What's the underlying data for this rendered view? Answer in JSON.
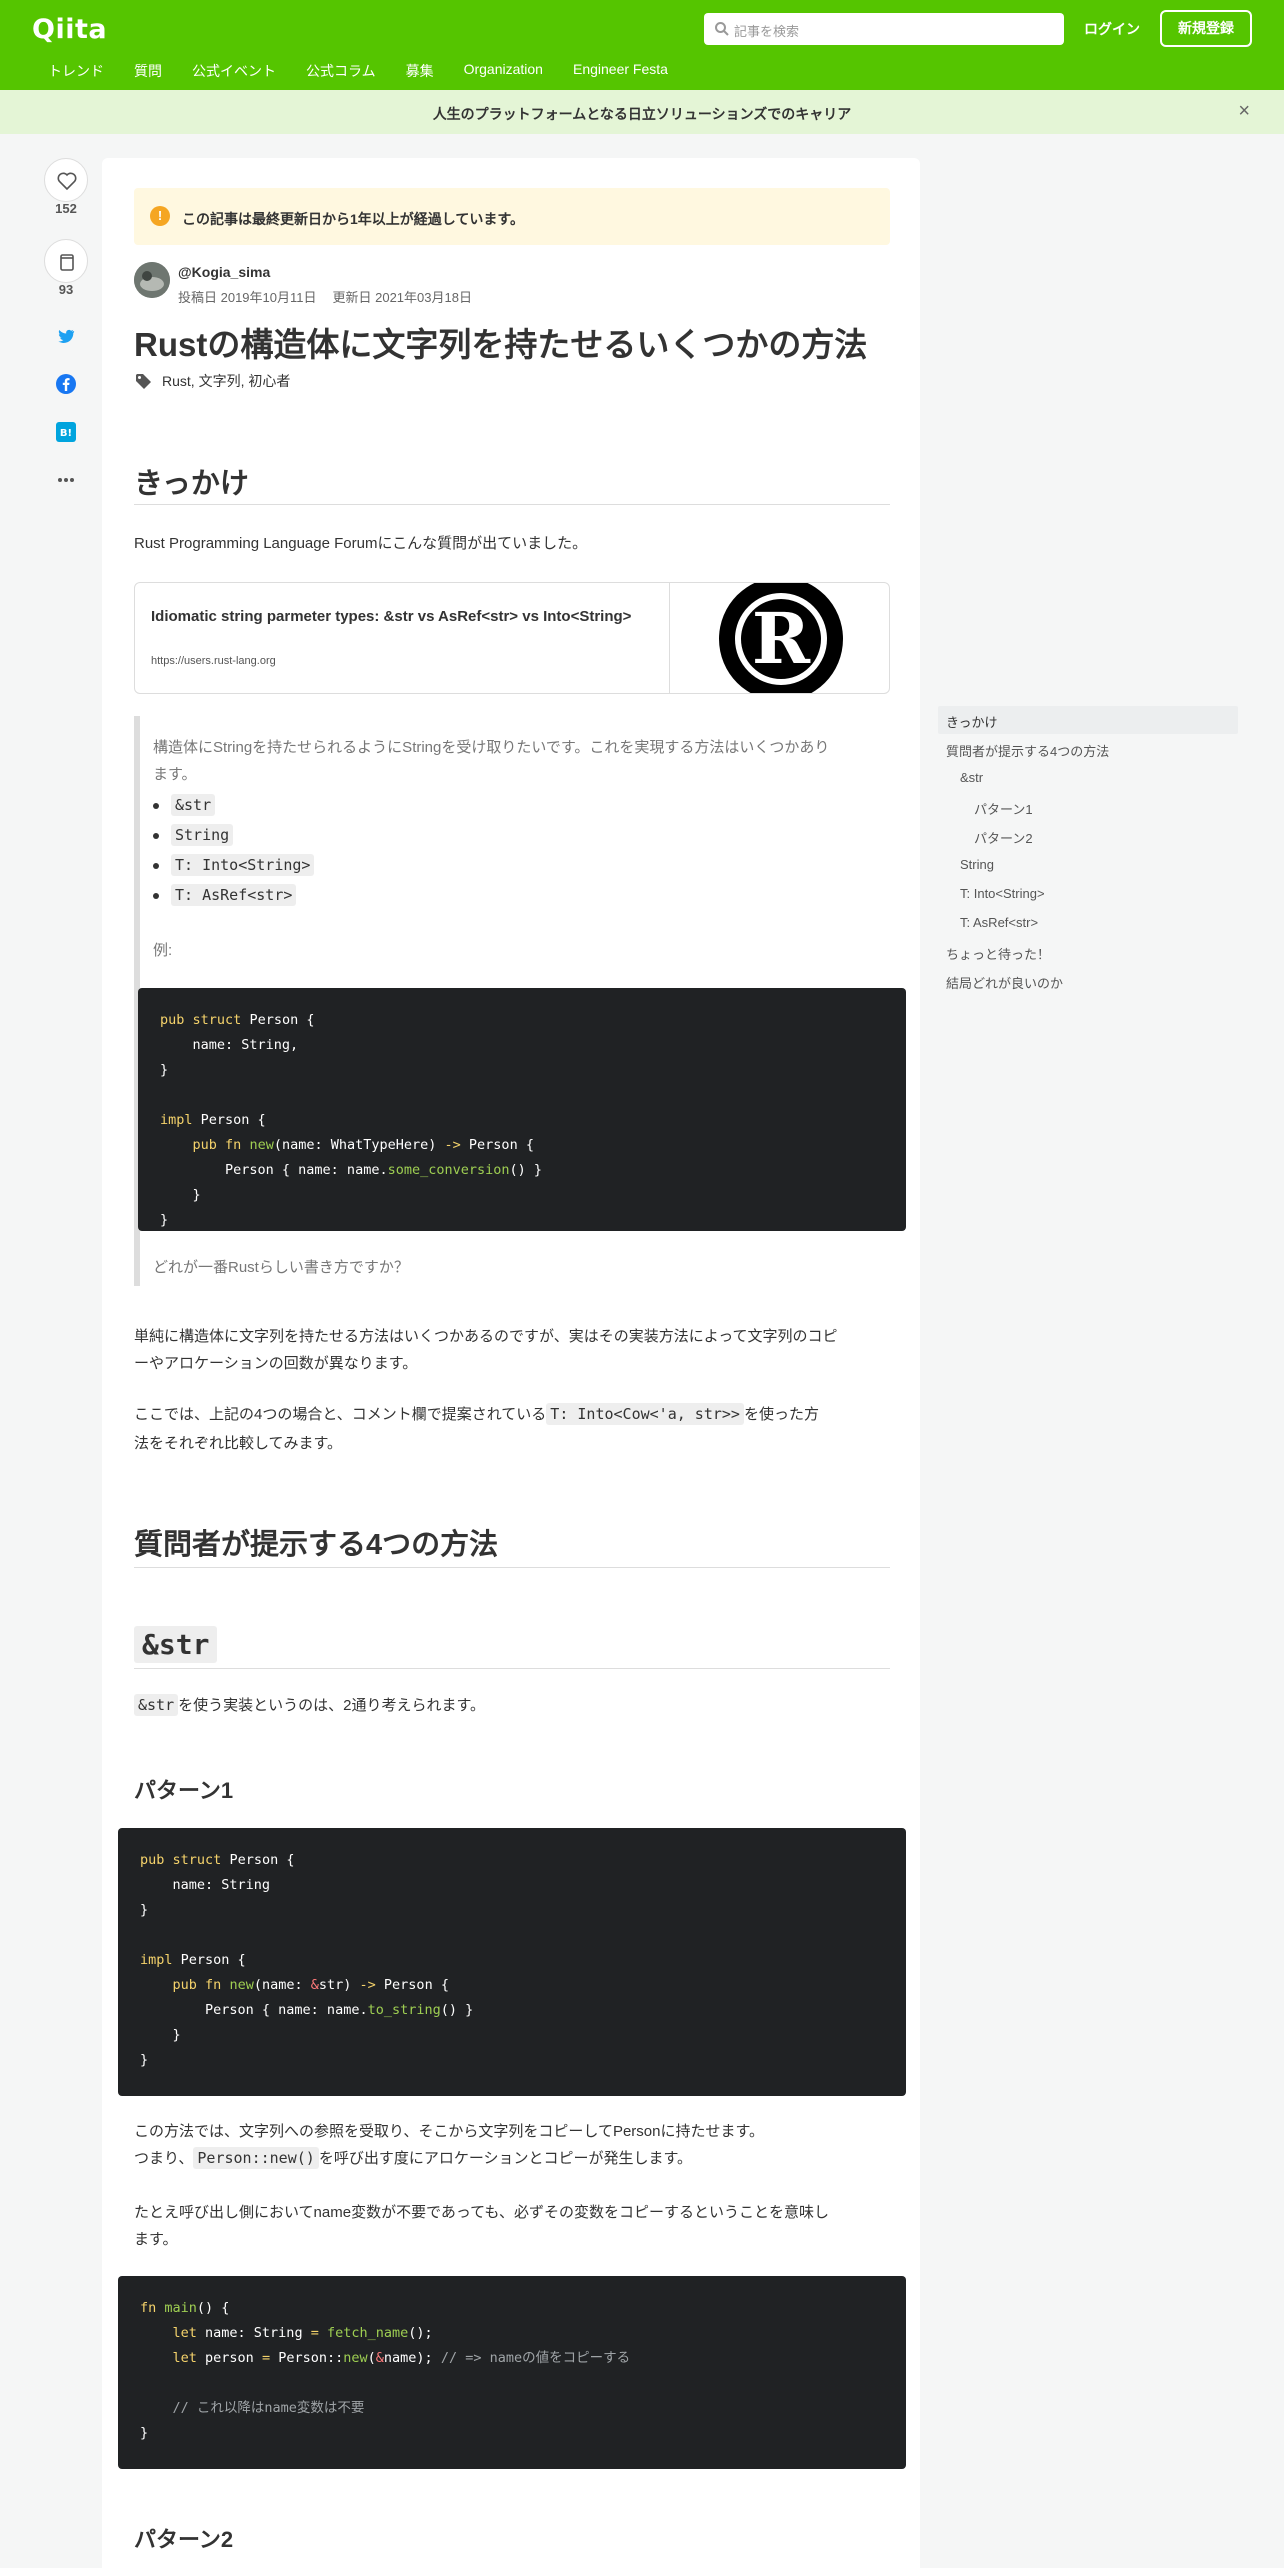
{
  "header": {
    "logo": "Qiita",
    "search_placeholder": "記事を検索",
    "login": "ログイン",
    "signup": "新規登録",
    "nav": [
      "トレンド",
      "質問",
      "公式イベント",
      "公式コラム",
      "募集",
      "Organization",
      "Engineer Festa"
    ]
  },
  "banner": {
    "text": "人生のプラットフォームとなる日立ソリューションズでのキャリア",
    "close": "×"
  },
  "side": {
    "likes": "152",
    "stocks": "93"
  },
  "article": {
    "warning": "この記事は最終更新日から1年以上が経過しています。",
    "author": "@Kogia_sima",
    "posted": "投稿日 2019年10月11日",
    "updated": "更新日 2021年03月18日",
    "title": "Rustの構造体に文字列を持たせるいくつかの方法",
    "tags": [
      "Rust",
      "文字列",
      "初心者"
    ],
    "h_kikkake": "きっかけ",
    "intro": "Rust Programming Language Forumにこんな質問が出ていました。",
    "link_title": "Idiomatic string parmeter types: &str vs AsRef<str> vs Into<String>",
    "link_url": "https://users.rust-lang.org",
    "quote_text1": "構造体にStringを持たせられるようにStringを受け取りたいです。これを実現する方法はいくつかあり",
    "quote_text2": "ます。",
    "quote_items": [
      "&str",
      "String",
      "T: Into<String>",
      "T: AsRef<str>"
    ],
    "quote_example": "例:",
    "quote_end": "どれが一番Rustらしい書き方ですか？",
    "para1a": "単純に構造体に文字列を持たせる方法はいくつかあるのですが、実はその実装方法によって文字列のコピ",
    "para1b": "ーやアロケーションの回数が異なります。",
    "para2a": "ここでは、上記の4つの場合と、コメント欄で提案されている",
    "para2code": "T: Into<Cow<'a, str>>",
    "para2b": "を使った方",
    "para2c": "法をそれぞれ比較してみます。",
    "h_methods": "質問者が提示する4つの方法",
    "h_str": "&str",
    "str_para_code": "&str",
    "str_para": "を使う実装というのは、2通り考えられます。",
    "h_p1": "パターン1",
    "p1_text1": "この方法では、文字列への参照を受取り、そこから文字列をコピーしてPersonに持たせます。",
    "p1_text2a": "つまり、",
    "p1_text2code": "Person::new()",
    "p1_text2b": "を呼び出す度にアロケーションとコピーが発生します。",
    "p1_text3a": "たとえ呼び出し側においてname変数が不要であっても、必ずその変数をコピーするということを意味し",
    "p1_text3b": "ます。",
    "h_p2": "パターン2",
    "code1_comment1": "// => nameの値をコピーする",
    "code1_comment2": "// これ以降はname変数は不要"
  },
  "toc": [
    "きっかけ",
    "質問者が提示する4つの方法",
    "&str",
    "パターン1",
    "パターン2",
    "String",
    "T: Into<String>",
    "T: AsRef<str>",
    "ちょっと待った！",
    "結局どれが良いのか"
  ]
}
